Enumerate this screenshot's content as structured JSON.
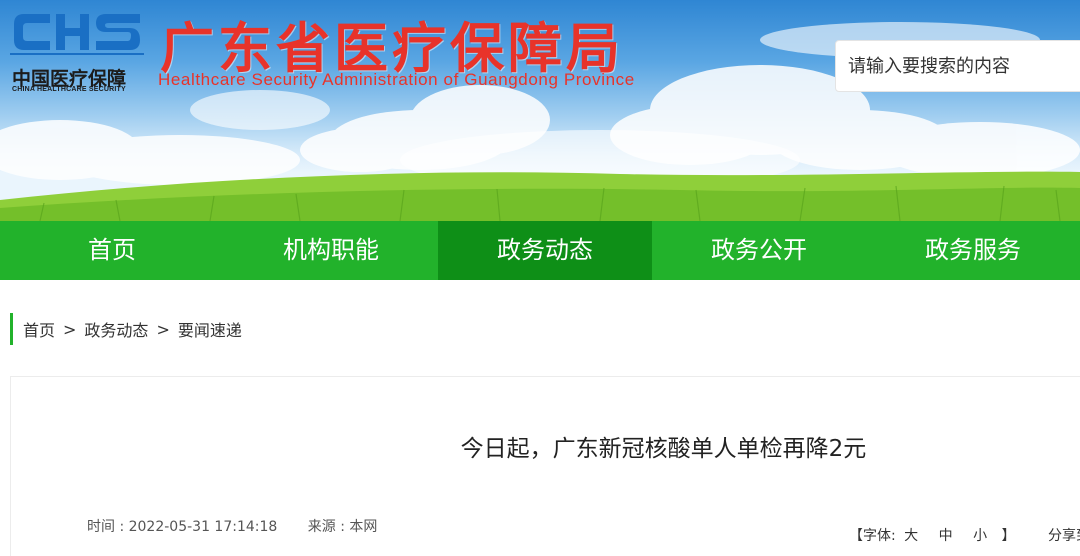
{
  "header": {
    "logo_mark": "CHS",
    "logo_cn": "中国医疗保障",
    "logo_en": "CHINA HEALTHCARE SECURITY",
    "title": "广东省医疗保障局",
    "subtitle": "Healthcare Security Administration of Guangdong Province",
    "search_placeholder": "请输入要搜索的内容"
  },
  "nav": {
    "items": [
      {
        "label": "首页",
        "active": false
      },
      {
        "label": "机构职能",
        "active": false
      },
      {
        "label": "政务动态",
        "active": true
      },
      {
        "label": "政务公开",
        "active": false
      },
      {
        "label": "政务服务",
        "active": false
      }
    ]
  },
  "breadcrumb": {
    "items": [
      "首页",
      "政务动态",
      "要闻速递"
    ],
    "separator": ">"
  },
  "article": {
    "title": "今日起，广东新冠核酸单人单检再降2元",
    "time": "时间 : 2022-05-31 17:14:18",
    "source": "来源 : 本网"
  },
  "tools": {
    "font_label": "【字体:",
    "size_large": "大",
    "size_medium": "中",
    "size_small": "小",
    "font_close": "】",
    "share_label": "分享到:"
  },
  "colors": {
    "nav_green": "#22b22b",
    "nav_active": "#0e8f17",
    "title_red": "#e8332a",
    "logo_blue": "#1a6fc4"
  }
}
